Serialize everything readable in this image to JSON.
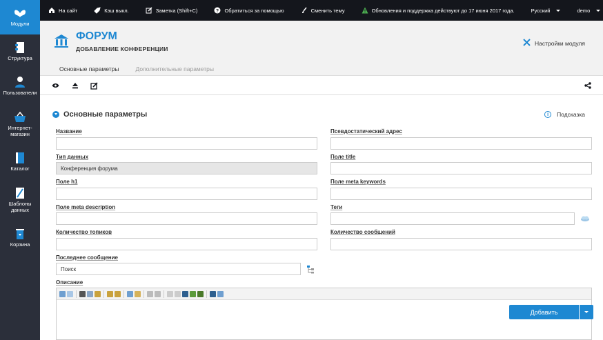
{
  "sidebar": {
    "items": [
      {
        "label": "Модули",
        "icon": "butterfly-icon",
        "active": true
      },
      {
        "label": "Структура",
        "icon": "structure-icon"
      },
      {
        "label": "Пользователи",
        "icon": "user-icon"
      },
      {
        "label": "Интернет-магазин",
        "icon": "basket-icon"
      },
      {
        "label": "Каталог",
        "icon": "book-icon"
      },
      {
        "label": "Шаблоны данных",
        "icon": "template-icon"
      },
      {
        "label": "Корзина",
        "icon": "recycle-bin-icon"
      }
    ]
  },
  "topbar": {
    "site": "На сайт",
    "cache": "Кэш выкл.",
    "note": "Заметка (Shift+C)",
    "help": "Обратиться за помощью",
    "theme": "Сменить тему",
    "update": "Обновления и поддержка действуют до 17 июня 2017 года.",
    "language": "Русский",
    "user": "demo"
  },
  "header": {
    "title": "ФОРУМ",
    "subtitle": "ДОБАВЛЕНИЕ КОНФЕРЕНЦИИ",
    "settings": "Настройки модуля"
  },
  "tabs": [
    {
      "label": "Основные параметры",
      "active": true
    },
    {
      "label": "Дополнительные параметры",
      "active": false
    }
  ],
  "section": {
    "title": "Основные параметры",
    "hint": "Подсказка"
  },
  "fields": {
    "name": {
      "label": "Название",
      "value": ""
    },
    "pseudo": {
      "label": "Псевдостатический адрес",
      "value": ""
    },
    "datatype": {
      "label": "Тип данных",
      "value": "Конференция форума"
    },
    "title": {
      "label": "Поле title",
      "value": ""
    },
    "h1": {
      "label": "Поле h1",
      "value": ""
    },
    "keywords": {
      "label": "Поле meta keywords",
      "value": ""
    },
    "description": {
      "label": "Поле meta description",
      "value": ""
    },
    "tags": {
      "label": "Теги",
      "value": ""
    },
    "topics": {
      "label": "Количество топиков",
      "value": ""
    },
    "messages": {
      "label": "Количество сообщений",
      "value": ""
    },
    "last": {
      "label": "Последнее сообщение",
      "value": "Поиск"
    },
    "desc": {
      "label": "Описание"
    }
  },
  "buttons": {
    "add": "Добавить"
  },
  "colors": {
    "accent": "#1e88d2",
    "sidebar": "#2b2f3a",
    "topbar": "#14161c",
    "update_icon": "#4caf50"
  }
}
